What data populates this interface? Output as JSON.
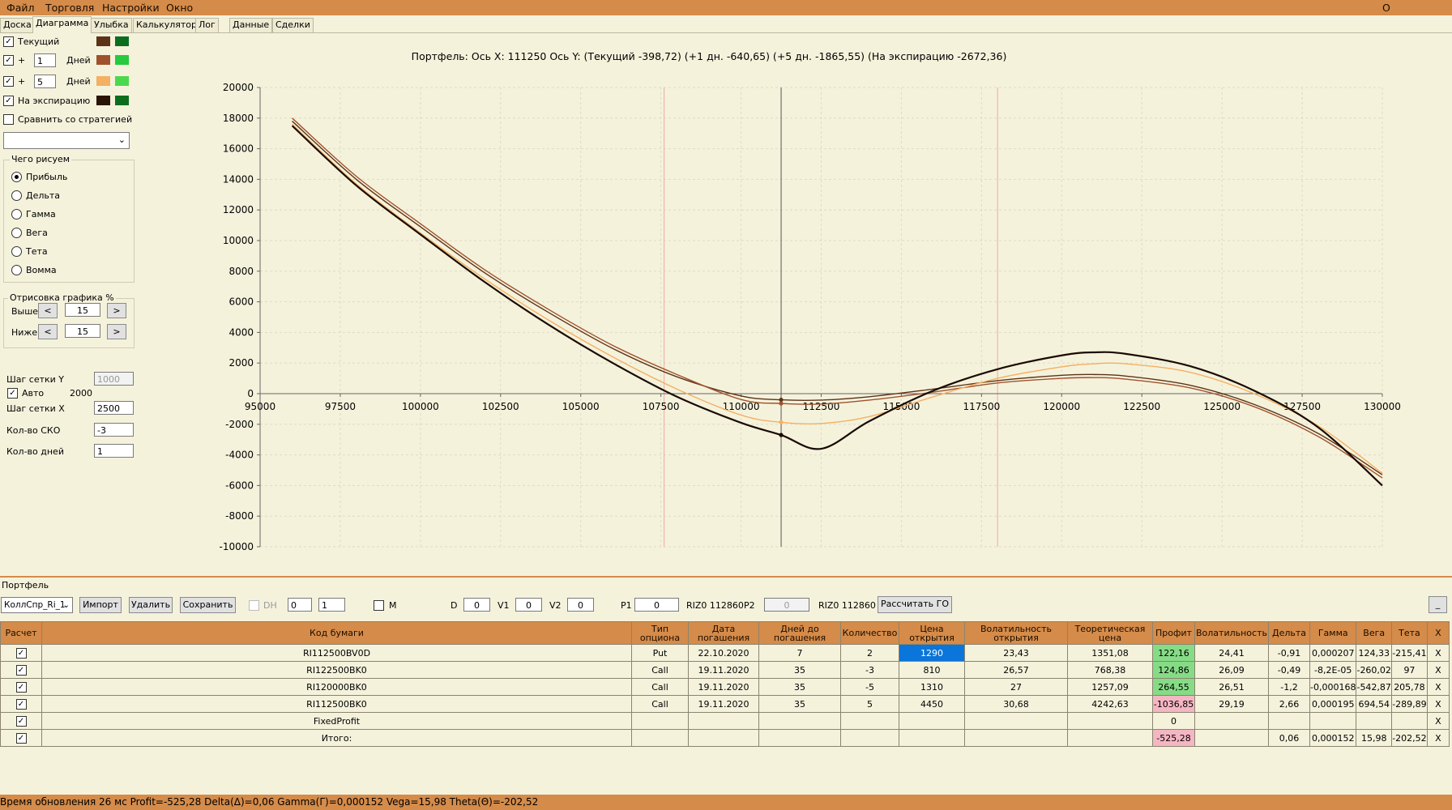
{
  "menu": {
    "file": "Файл",
    "trading": "Торговля",
    "settings": "Настройки",
    "window": "Окно",
    "about": "О программе"
  },
  "tabs": [
    "Доска",
    "Диаграмма",
    "Улыбка",
    "Калькулятор",
    "Лог",
    "Данные",
    "Сделки"
  ],
  "left_panel": {
    "current_label": "Текущий",
    "plus": "+",
    "days_label": "Дней",
    "plus_days_1": "1",
    "plus_days_2": "5",
    "expiration_label": "На экспирацию",
    "compare_label": "Сравнить со стратегией",
    "what_draw_title": "Чего рисуем",
    "radio_options": [
      "Прибыль",
      "Дельта",
      "Гамма",
      "Вега",
      "Тета",
      "Вомма"
    ],
    "drawing_title": "Отрисовка графика %",
    "above_label": "Выше",
    "above_value": "15",
    "below_label": "Ниже",
    "below_value": "15",
    "left_arrow": "<",
    "right_arrow": ">",
    "grid_step_y_label": "Шаг сетки Y",
    "grid_step_y_value": "1000",
    "auto_label": "Авто",
    "auto_value": "2000",
    "grid_step_x_label": "Шаг сетки X",
    "grid_step_x_value": "2500",
    "sko_label": "Кол-во СКО",
    "sko_value": "-3",
    "days_count_label": "Кол-во дней",
    "days_count_value": "1",
    "colors": {
      "current_a": "#5C3317",
      "current_b": "#0B6E1F",
      "d1_a": "#A0522D",
      "d1_b": "#27C93F",
      "d5_a": "#F4B063",
      "d5_b": "#4CD84C",
      "exp_a": "#2A1406",
      "exp_b": "#0B6E1F"
    }
  },
  "chart_header": "Портфель: Ось X: 111250 Ось Y:  (Текущий -398,72)  (+1 дн. -640,65)  (+5 дн. -1865,55)  (На экспирацию -2672,36)",
  "chart_data": {
    "type": "line",
    "xlim": [
      95000,
      130000
    ],
    "ylim": [
      -10000,
      20000
    ],
    "x_ticks": [
      "95000",
      "97500",
      "100000",
      "102500",
      "105000",
      "107500",
      "110000",
      "112500",
      "115000",
      "117500",
      "120000",
      "122500",
      "125000",
      "127500",
      "130000"
    ],
    "y_ticks": [
      "20000",
      "18000",
      "16000",
      "14000",
      "12000",
      "10000",
      "8000",
      "6000",
      "4000",
      "2000",
      "0",
      "-2000",
      "-4000",
      "-6000",
      "-8000",
      "-10000"
    ],
    "cursor_x": 111250,
    "marker_lines_x": [
      107600,
      118000
    ],
    "grid": true,
    "series": [
      {
        "color": "#5C3317",
        "x": [
          96000,
          98000,
          100000,
          102000,
          104000,
          106000,
          108000,
          110000,
          111250,
          112500,
          114000,
          116000,
          118000,
          120000,
          121000,
          122000,
          124000,
          126000,
          128000,
          130000
        ],
        "y": [
          17800,
          14000,
          10900,
          7900,
          5300,
          2950,
          1100,
          -150,
          -400,
          -420,
          -200,
          300,
          850,
          1200,
          1250,
          1150,
          550,
          -700,
          -2600,
          -5300
        ]
      },
      {
        "color": "#A0522D",
        "x": [
          96000,
          98000,
          100000,
          102000,
          104000,
          106000,
          108000,
          110000,
          111250,
          112500,
          114000,
          116000,
          118000,
          120000,
          121000,
          122000,
          124000,
          126000,
          128000,
          130000
        ],
        "y": [
          18000,
          14200,
          11100,
          8100,
          5500,
          3150,
          1250,
          -380,
          -640,
          -680,
          -420,
          100,
          700,
          1000,
          1050,
          950,
          380,
          -850,
          -2800,
          -5500
        ]
      },
      {
        "color": "#F4B063",
        "x": [
          96000,
          98000,
          100000,
          102000,
          104000,
          106000,
          108000,
          110000,
          111250,
          112500,
          114000,
          116000,
          118000,
          120000,
          121000,
          122000,
          124000,
          126000,
          128000,
          130000
        ],
        "y": [
          17600,
          13700,
          10500,
          7500,
          4800,
          2400,
          300,
          -1400,
          -1870,
          -1950,
          -1500,
          -200,
          1000,
          1750,
          1950,
          1950,
          1400,
          0,
          -2100,
          -5200
        ]
      },
      {
        "color": "#1A0B03",
        "x": [
          96000,
          98000,
          100000,
          102000,
          104000,
          106000,
          108000,
          110000,
          111250,
          112500,
          114000,
          116000,
          118000,
          120000,
          121000,
          122000,
          124000,
          126000,
          128000,
          130000
        ],
        "y": [
          17500,
          13600,
          10400,
          7300,
          4500,
          2000,
          -200,
          -1900,
          -2700,
          -3600,
          -1800,
          200,
          1600,
          2500,
          2700,
          2600,
          1800,
          200,
          -2200,
          -6000
        ]
      }
    ]
  },
  "portfolio": {
    "title": "Портфель",
    "select_value": "КоллСпр_Ri_1",
    "import_label": "Импорт",
    "delete_label": "Удалить",
    "save_label": "Сохранить",
    "dh_label": "DH",
    "spin1": "0",
    "spin2": "1",
    "m_label": "M",
    "d_label": "D",
    "d_value": "0",
    "v1_label": "V1",
    "v1_value": "0",
    "v2_label": "V2",
    "v2_value": "0",
    "p1_label": "P1",
    "p1_value": "0",
    "riz1": "RIZ0 112860",
    "p2_label": "P2",
    "p2_value": "0",
    "riz2": "RIZ0 112860",
    "calc_go_label": "Рассчитать ГО",
    "minimize_label": "_"
  },
  "table": {
    "headers": [
      "Расчет",
      "Код бумаги",
      "Тип опциона",
      "Дата погашения",
      "Дней до погашения",
      "Количество",
      "Цена открытия",
      "Волатильность открытия",
      "Теоретическая цена",
      "Профит",
      "Волатильность",
      "Дельта",
      "Гамма",
      "Вега",
      "Тета",
      "X"
    ],
    "rows": [
      {
        "code": "RI112500BV0D",
        "type": "Put",
        "date": "22.10.2020",
        "days": "7",
        "qty": "2",
        "open": "1290",
        "vol_open": "23,43",
        "theo": "1351,08",
        "profit": "122,16",
        "vol": "24,41",
        "delta": "-0,91",
        "gamma": "0,000207",
        "vega": "124,33",
        "theta": "-215,41",
        "x": "X"
      },
      {
        "code": "RI122500BK0",
        "type": "Call",
        "date": "19.11.2020",
        "days": "35",
        "qty": "-3",
        "open": "810",
        "vol_open": "26,57",
        "theo": "768,38",
        "profit": "124,86",
        "vol": "26,09",
        "delta": "-0,49",
        "gamma": "-8,2E-05",
        "vega": "-260,02",
        "theta": "97",
        "x": "X"
      },
      {
        "code": "RI120000BK0",
        "type": "Call",
        "date": "19.11.2020",
        "days": "35",
        "qty": "-5",
        "open": "1310",
        "vol_open": "27",
        "theo": "1257,09",
        "profit": "264,55",
        "vol": "26,51",
        "delta": "-1,2",
        "gamma": "-0,000168",
        "vega": "-542,87",
        "theta": "205,78",
        "x": "X"
      },
      {
        "code": "RI112500BK0",
        "type": "Call",
        "date": "19.11.2020",
        "days": "35",
        "qty": "5",
        "open": "4450",
        "vol_open": "30,68",
        "theo": "4242,63",
        "profit": "-1036,85",
        "vol": "29,19",
        "delta": "2,66",
        "gamma": "0,000195",
        "vega": "694,54",
        "theta": "-289,89",
        "x": "X"
      },
      {
        "code": "FixedProfit",
        "type": "",
        "date": "",
        "days": "",
        "qty": "",
        "open": "",
        "vol_open": "",
        "theo": "",
        "profit": "0",
        "vol": "",
        "delta": "",
        "gamma": "",
        "vega": "",
        "theta": "",
        "x": "X"
      },
      {
        "code": "Итого:",
        "type": "",
        "date": "",
        "days": "",
        "qty": "",
        "open": "",
        "vol_open": "",
        "theo": "",
        "profit": "-525,28",
        "vol": "",
        "delta": "0,06",
        "gamma": "0,000152",
        "vega": "15,98",
        "theta": "-202,52",
        "x": "X"
      }
    ]
  },
  "status_text": "Время обновления 26 мс  Profit=-525,28 Delta(Δ)=0,06 Gamma(Γ)=0,000152 Vega=15,98 Theta(Θ)=-202,52"
}
